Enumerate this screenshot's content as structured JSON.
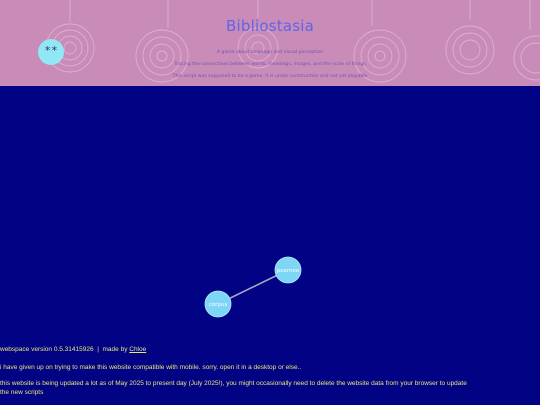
{
  "header": {
    "title": "Bibliostasia",
    "tagline_lines": [
      "A game about language and visual perception",
      "Tracing the connections between words, meanings, images, and the scale of things",
      "This script was supposed to be a game. It is under construction and not yet playable"
    ],
    "badge_text": "**"
  },
  "graph": {
    "nodes": [
      {
        "id": "poemeo",
        "label": "poemeo"
      },
      {
        "id": "corpus",
        "label": "corpus"
      }
    ],
    "edges": [
      {
        "from": "corpus",
        "to": "poemeo"
      }
    ],
    "node_color": "#7dd6f6",
    "edge_color": "#a8a6c8"
  },
  "footer": {
    "version_prefix": "webspace version 0.5.31415926  |  made by ",
    "author_link": "Chloe",
    "mobile_notice": "i have given up on trying to make this website compatible with mobile. sorry. open it in a desktop or else..",
    "update_notice_1": "this website is being updated a lot as of May 2025 to present day (July 2025!), you might occasionally need to delete the website data from your browser to update",
    "update_notice_2": "the new scripts"
  },
  "colors": {
    "page_background": "#020284",
    "header_background": "#c98bb8",
    "title": "#5e66e6",
    "footer_text": "#e6e87a"
  }
}
